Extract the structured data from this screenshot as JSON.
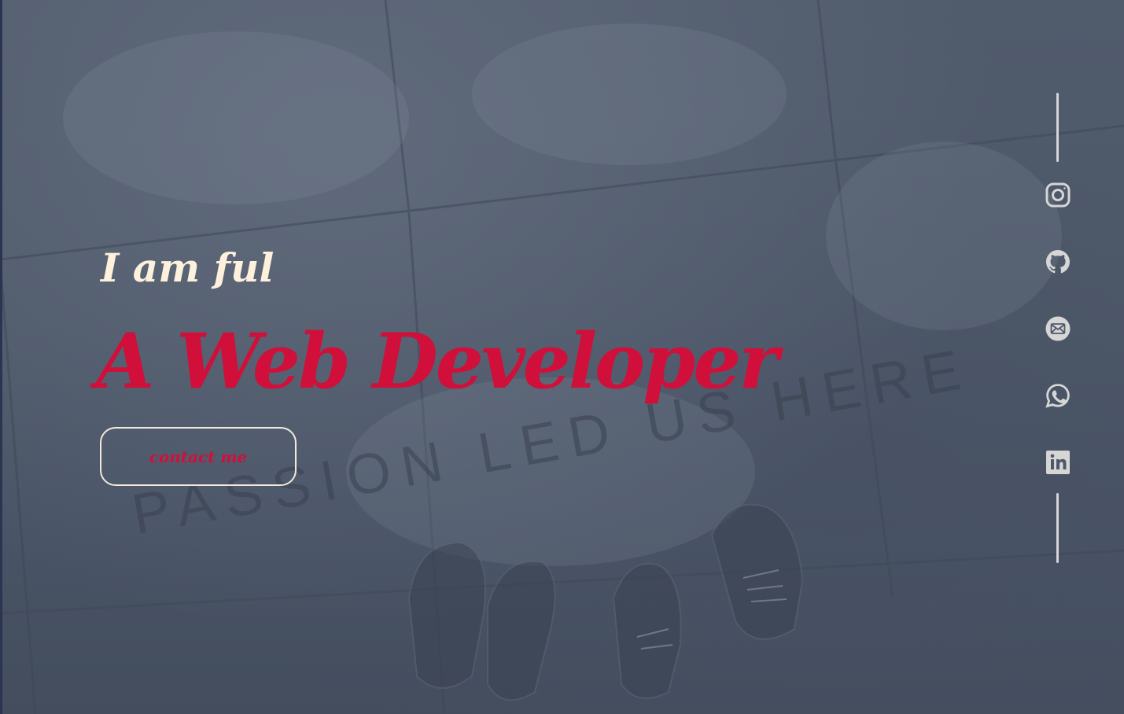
{
  "hero": {
    "greeting": "I am ful",
    "headline": "A Web Developer",
    "contact_label": "contact me",
    "background_text": "PASSION LED US HERE"
  },
  "social": [
    {
      "icon": "instagram-icon"
    },
    {
      "icon": "github-icon"
    },
    {
      "icon": "email-icon"
    },
    {
      "icon": "whatsapp-icon"
    },
    {
      "icon": "linkedin-icon"
    }
  ],
  "colors": {
    "accent": "#d0103a",
    "greeting": "#fdf0dc",
    "icon": "#d6d6d6",
    "overlay": "#4a5568"
  }
}
